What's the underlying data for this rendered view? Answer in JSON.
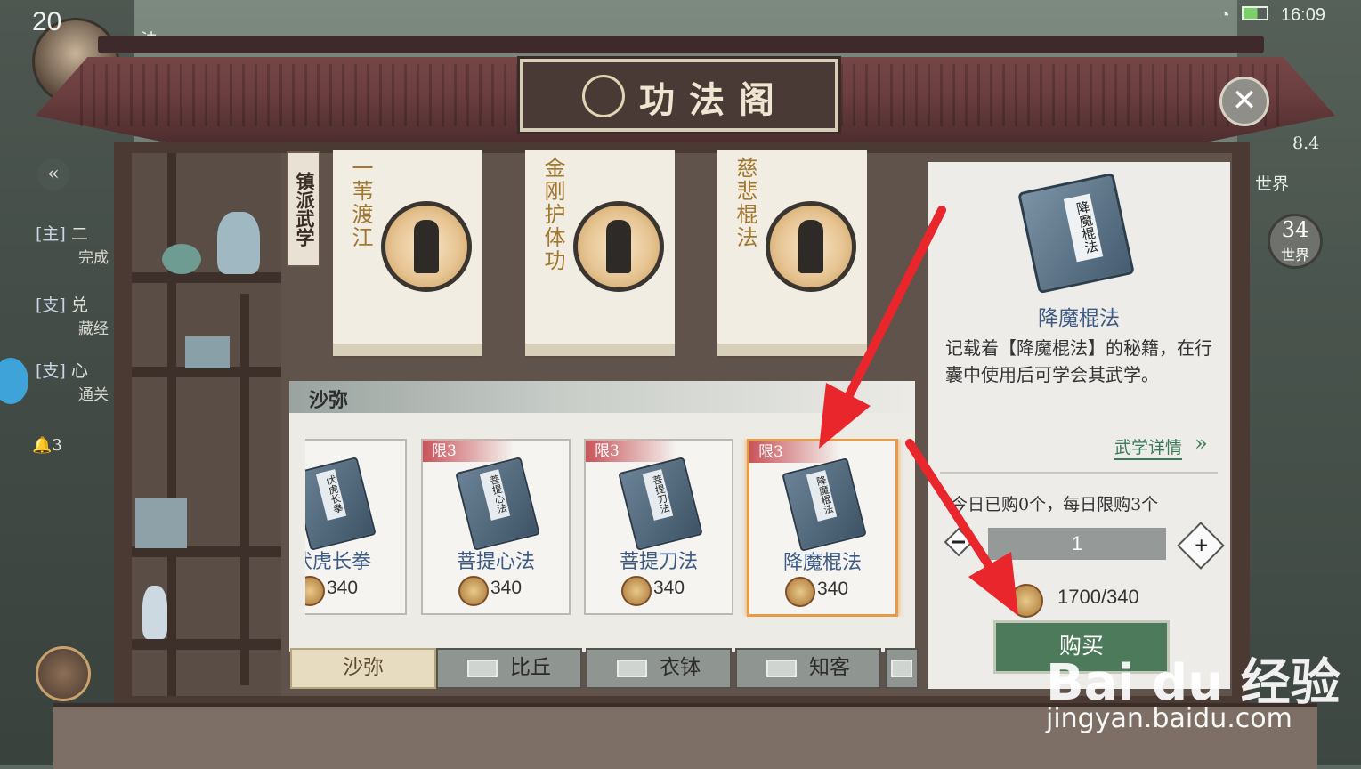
{
  "status_bar": {
    "time": "16:09"
  },
  "player": {
    "level": "20"
  },
  "left_hud": {
    "top_label": "法",
    "quests": [
      {
        "tag": "[主]",
        "name": "二",
        "sub": "完成"
      },
      {
        "tag": "[支]",
        "name": "兑",
        "sub": "藏经"
      },
      {
        "tag": "[支]",
        "name": "心",
        "sub": "通关"
      }
    ],
    "bell_count": "3"
  },
  "right_hud": {
    "value": "8.4",
    "channel": "世界",
    "badge_num": "34",
    "badge_label": "世界"
  },
  "window": {
    "title": "功法阁"
  },
  "featured": {
    "tag": "镇派武学",
    "scrolls": [
      {
        "name": "一苇渡江"
      },
      {
        "name": "金刚护体功"
      },
      {
        "name": "慈悲棍法"
      }
    ]
  },
  "shop": {
    "section_title": "沙弥",
    "items": [
      {
        "name": "伏虎长拳",
        "price": "340",
        "limit": "",
        "book_label": "伏虎长拳"
      },
      {
        "name": "菩提心法",
        "price": "340",
        "limit": "限3",
        "book_label": "菩提心法"
      },
      {
        "name": "菩提刀法",
        "price": "340",
        "limit": "限3",
        "book_label": "菩提刀法"
      },
      {
        "name": "降魔棍法",
        "price": "340",
        "limit": "限3",
        "book_label": "降魔棍法"
      }
    ],
    "tabs": [
      {
        "label": "沙弥"
      },
      {
        "label": "比丘"
      },
      {
        "label": "衣钵"
      },
      {
        "label": "知客"
      }
    ]
  },
  "detail": {
    "book_label": "降魔棍法",
    "name": "降魔棍法",
    "description": "记载着【降魔棍法】的秘籍，在行囊中使用后可学会其武学。",
    "more_link": "武学详情",
    "daily_limit": "今日已购0个，每日限购3个",
    "quantity": "1",
    "plus": "+",
    "cost": "1700/340",
    "buy_label": "购买"
  },
  "watermark": {
    "logo": "Bai du 经验",
    "url": "jingyan.baidu.com"
  },
  "colors": {
    "arrow": "#e8262b",
    "buy_button": "#4c7a5b",
    "item_name": "#3d5a86",
    "roof": "#6b3e3f"
  }
}
